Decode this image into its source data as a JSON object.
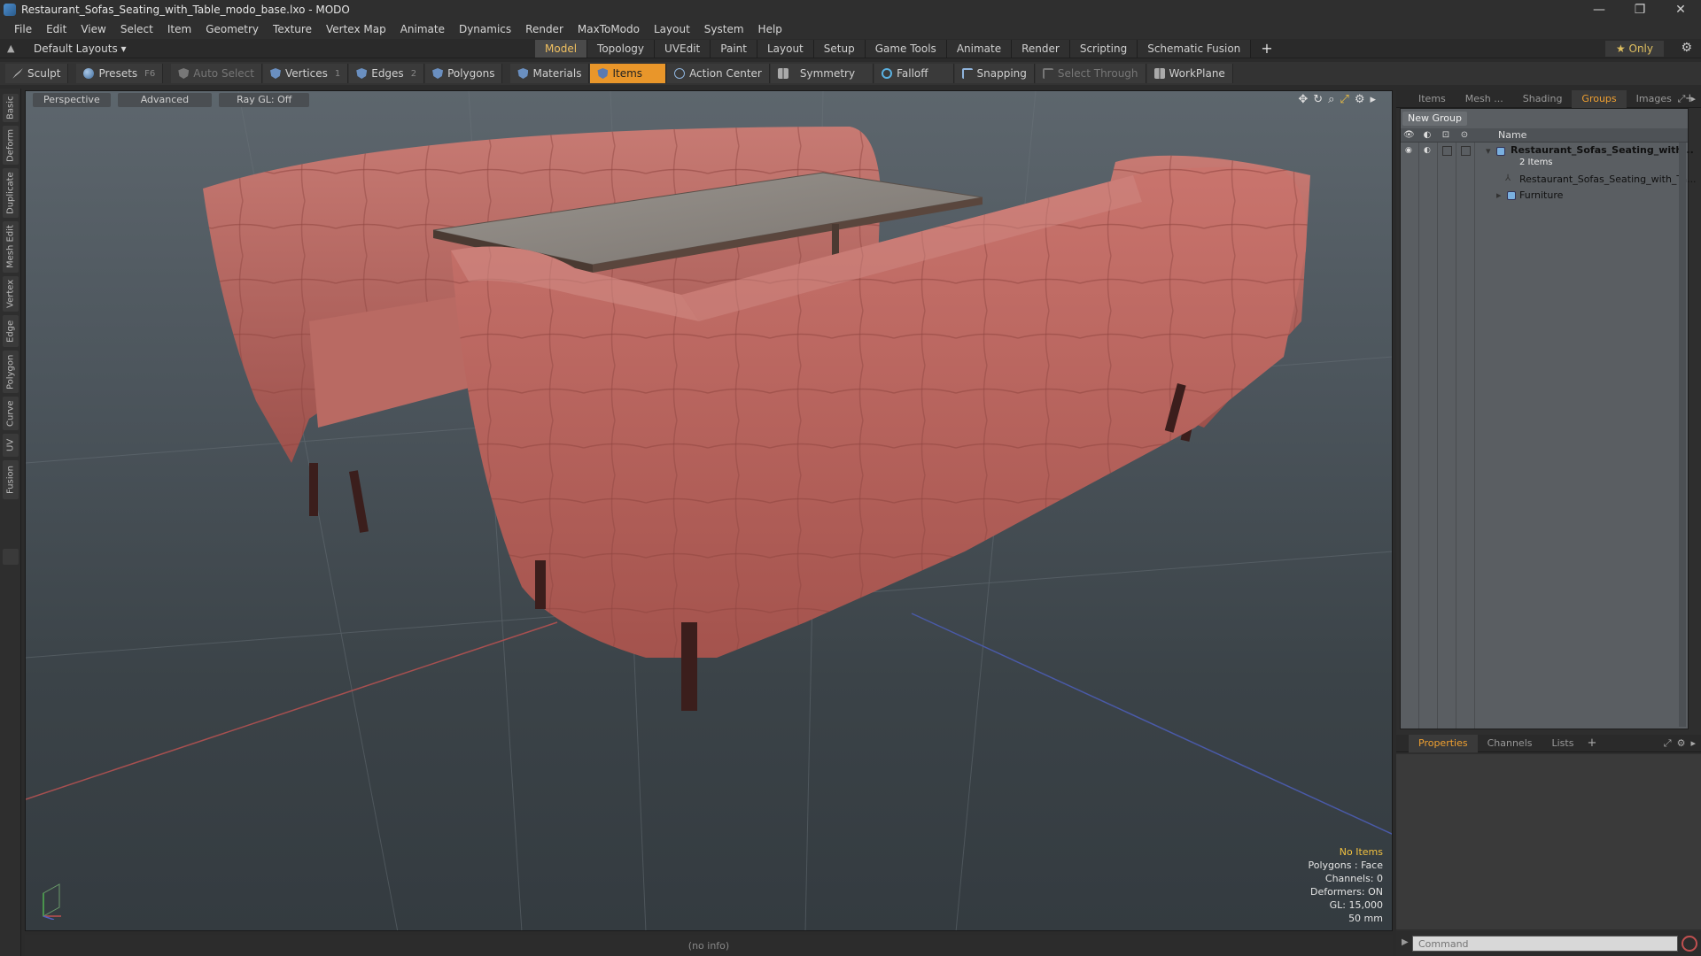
{
  "window": {
    "title": "Restaurant_Sofas_Seating_with_Table_modo_base.lxo - MODO",
    "controls": [
      "—",
      "❐",
      "✕"
    ]
  },
  "menu": [
    "File",
    "Edit",
    "View",
    "Select",
    "Item",
    "Geometry",
    "Texture",
    "Vertex Map",
    "Animate",
    "Dynamics",
    "Render",
    "MaxToModo",
    "Layout",
    "System",
    "Help"
  ],
  "layout": {
    "selector": "Default Layouts ▾",
    "tabs": [
      "Model",
      "Topology",
      "UVEdit",
      "Paint",
      "Layout",
      "Setup",
      "Game Tools",
      "Animate",
      "Render",
      "Scripting",
      "Schematic Fusion"
    ],
    "active_tab": "Model",
    "only_label": "★  Only"
  },
  "toolbar": {
    "sculpt": "Sculpt",
    "presets": "Presets",
    "presets_key": "F6",
    "auto_select": "Auto Select",
    "vertices": "Vertices",
    "vertices_count": "1",
    "edges": "Edges",
    "edges_count": "2",
    "polygons": "Polygons",
    "materials": "Materials",
    "items": "Items",
    "action_center": "Action Center",
    "symmetry": "Symmetry",
    "falloff": "Falloff",
    "snapping": "Snapping",
    "select_through": "Select Through",
    "workplane": "WorkPlane"
  },
  "left_rail": [
    "Basic",
    "Deform",
    "Duplicate",
    "Mesh Edit",
    "Vertex",
    "Edge",
    "Polygon",
    "Curve",
    "UV",
    "Fusion"
  ],
  "viewport": {
    "view_mode": "Perspective",
    "shading": "Advanced",
    "raygl": "Ray GL: Off",
    "info": {
      "selection": "No Items",
      "polygons": "Polygons : Face",
      "channels": "Channels: 0",
      "deformers": "Deformers: ON",
      "gl": "GL: 15,000",
      "scale": "50 mm"
    }
  },
  "status": "(no info)",
  "right_panel": {
    "tabs": [
      "Items",
      "Mesh ...",
      "Shading",
      "Groups",
      "Images"
    ],
    "active_tab": "Groups",
    "new_group": "New Group",
    "name_header": "Name",
    "tree": {
      "group_name": "Restaurant_Sofas_Seating_with...",
      "group_count": "2 Items",
      "child_mesh": "Restaurant_Sofas_Seating_with_Ta...",
      "child_group": "Furniture"
    },
    "bottom_tabs": [
      "Properties",
      "Channels",
      "Lists"
    ],
    "bottom_active": "Properties",
    "command_placeholder": "Command"
  },
  "colors": {
    "accent": "#e9962a",
    "sofa": "#b5605a",
    "table_top": "#8a8580"
  }
}
